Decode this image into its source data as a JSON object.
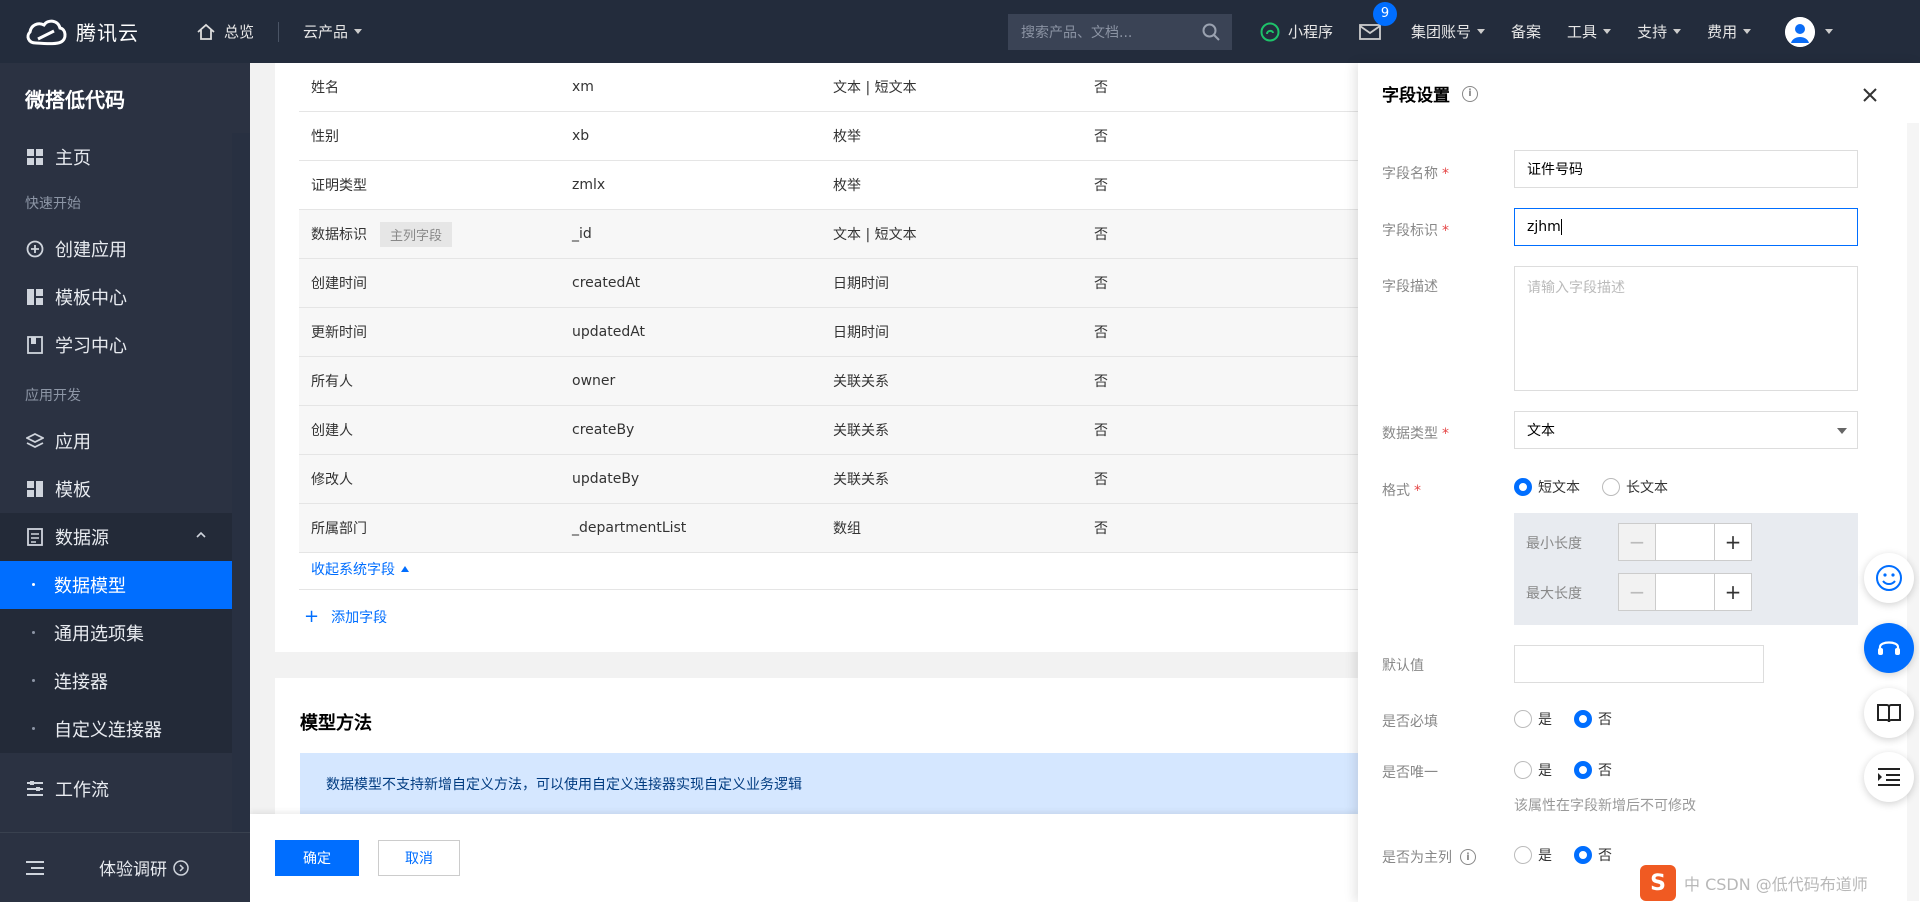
{
  "topbar": {
    "brand": "腾讯云",
    "overview": "总览",
    "products": "云产品",
    "search_placeholder": "搜索产品、文档...",
    "mini_program": "小程序",
    "mail_badge": "9",
    "group_account": "集团账号",
    "filing": "备案",
    "tools": "工具",
    "support": "支持",
    "fees": "费用"
  },
  "sidebar": {
    "title": "微搭低代码",
    "home": "主页",
    "section_quick": "快速开始",
    "create_app": "创建应用",
    "template_center": "模板中心",
    "learn_center": "学习中心",
    "section_dev": "应用开发",
    "apps": "应用",
    "templates": "模板",
    "datasource": "数据源",
    "sub_items": [
      "数据模型",
      "通用选项集",
      "连接器",
      "自定义连接器"
    ],
    "workflow": "工作流",
    "survey": "体验调研"
  },
  "fields_table": {
    "rows": [
      {
        "name": "姓名",
        "id": "xm",
        "type": "文本 | 短文本",
        "required": "否",
        "tag": ""
      },
      {
        "name": "性别",
        "id": "xb",
        "type": "枚举",
        "required": "否",
        "tag": ""
      },
      {
        "name": "证明类型",
        "id": "zmlx",
        "type": "枚举",
        "required": "否",
        "tag": ""
      },
      {
        "name": "数据标识",
        "id": "_id",
        "type": "文本 | 短文本",
        "required": "否",
        "tag": "主列字段"
      },
      {
        "name": "创建时间",
        "id": "createdAt",
        "type": "日期时间",
        "required": "否",
        "tag": ""
      },
      {
        "name": "更新时间",
        "id": "updatedAt",
        "type": "日期时间",
        "required": "否",
        "tag": ""
      },
      {
        "name": "所有人",
        "id": "owner",
        "type": "关联关系",
        "required": "否",
        "tag": ""
      },
      {
        "name": "创建人",
        "id": "createBy",
        "type": "关联关系",
        "required": "否",
        "tag": ""
      },
      {
        "name": "修改人",
        "id": "updateBy",
        "type": "关联关系",
        "required": "否",
        "tag": ""
      },
      {
        "name": "所属部门",
        "id": "_departmentList",
        "type": "数组",
        "required": "否",
        "tag": ""
      }
    ],
    "collapse_label": "收起系统字段",
    "add_field_label": "添加字段"
  },
  "methods": {
    "title": "模型方法",
    "notice": "数据模型不支持新增自定义方法，可以使用自定义连接器实现自定义业务逻辑"
  },
  "footer": {
    "confirm": "确定",
    "cancel": "取消"
  },
  "panel": {
    "title": "字段设置",
    "field_name_label": "字段名称",
    "field_name_value": "证件号码",
    "field_id_label": "字段标识",
    "field_id_value": "zjhm",
    "desc_label": "字段描述",
    "desc_placeholder": "请输入字段描述",
    "data_type_label": "数据类型",
    "data_type_value": "文本",
    "format_label": "格式",
    "format_short": "短文本",
    "format_long": "长文本",
    "min_len_label": "最小长度",
    "max_len_label": "最大长度",
    "default_label": "默认值",
    "required_label": "是否必填",
    "unique_label": "是否唯一",
    "unique_hint": "该属性在字段新增后不可修改",
    "primary_label": "是否为主列",
    "yes": "是",
    "no": "否"
  },
  "watermark": "中 CSDN @低代码布道师"
}
